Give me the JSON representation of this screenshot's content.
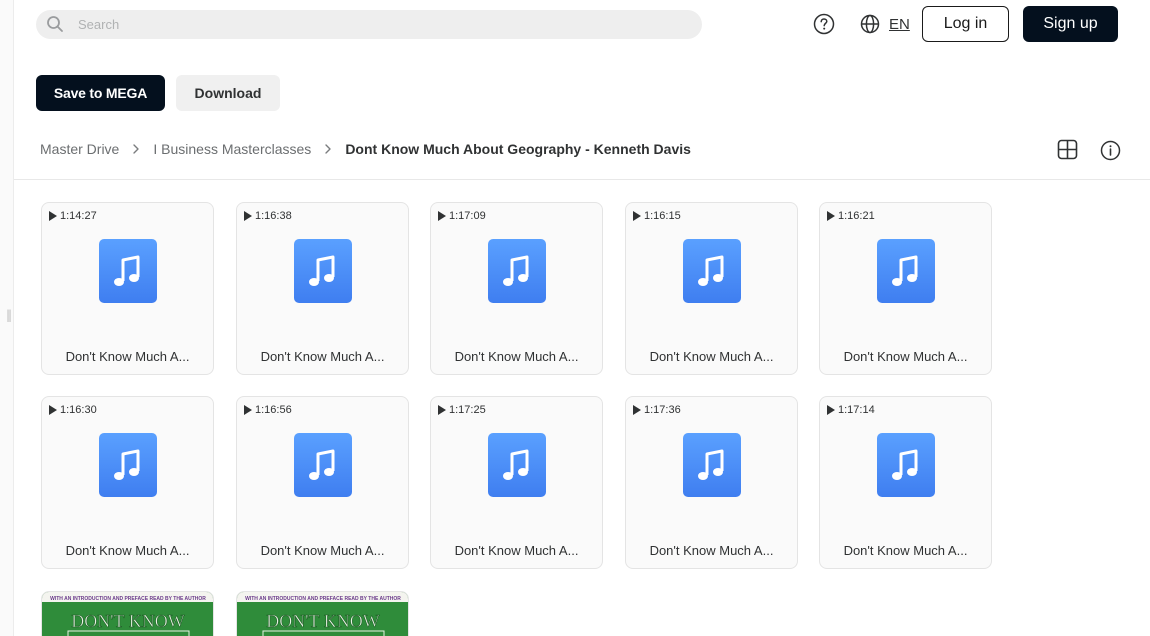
{
  "search": {
    "placeholder": "Search"
  },
  "header": {
    "language": "EN",
    "login_label": "Log in",
    "signup_label": "Sign up"
  },
  "actions": {
    "save_label": "Save to MEGA",
    "download_label": "Download"
  },
  "breadcrumb": [
    "Master Drive",
    "I Business Masterclasses",
    "Dont Know Much About Geography - Kenneth Davis"
  ],
  "files": [
    {
      "duration": "1:14:27",
      "name": "Don't Know Much A..."
    },
    {
      "duration": "1:16:38",
      "name": "Don't Know Much A..."
    },
    {
      "duration": "1:17:09",
      "name": "Don't Know Much A..."
    },
    {
      "duration": "1:16:15",
      "name": "Don't Know Much A..."
    },
    {
      "duration": "1:16:21",
      "name": "Don't Know Much A..."
    },
    {
      "duration": "1:16:30",
      "name": "Don't Know Much A..."
    },
    {
      "duration": "1:16:56",
      "name": "Don't Know Much A..."
    },
    {
      "duration": "1:17:25",
      "name": "Don't Know Much A..."
    },
    {
      "duration": "1:17:36",
      "name": "Don't Know Much A..."
    },
    {
      "duration": "1:17:14",
      "name": "Don't Know Much A..."
    }
  ],
  "image_files": [
    {
      "cover_tagline": "WITH AN INTRODUCTION AND PREFACE READ BY THE AUTHOR",
      "cover_title": "DON'T KNOW"
    },
    {
      "cover_tagline": "WITH AN INTRODUCTION AND PREFACE READ BY THE AUTHOR",
      "cover_title": "DON'T KNOW"
    }
  ],
  "colors": {
    "primary_dark": "#04101e",
    "audio_icon_top": "#5aa0ff",
    "audio_icon_bottom": "#3f7ef0",
    "cover_green": "#2f8c3a"
  },
  "icons": {
    "search": "search-icon",
    "help": "help-icon",
    "language": "globe-icon",
    "breadcrumb_separator": "chevron-right-icon",
    "view_mode": "grid-view-icon",
    "info": "info-icon",
    "duration": "play-icon",
    "file_type": "audio-file-icon"
  }
}
